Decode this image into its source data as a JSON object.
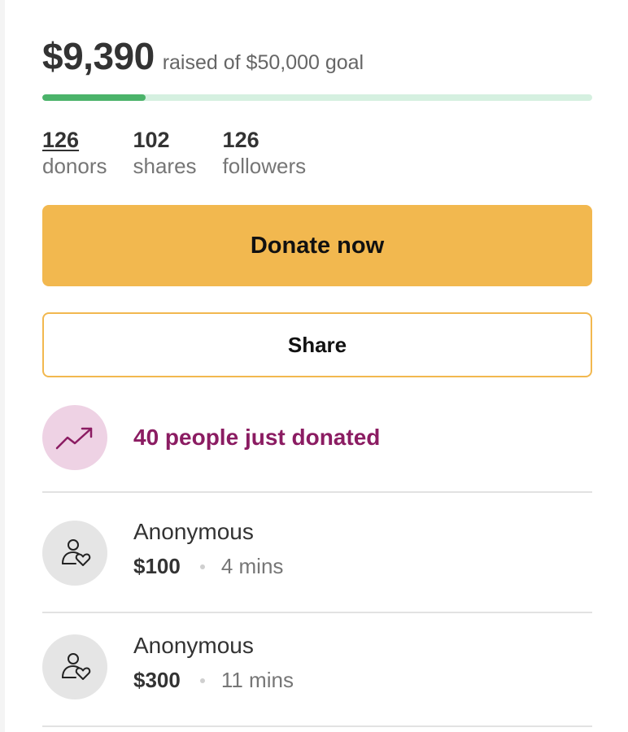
{
  "fundraiser": {
    "raised": "$9,390",
    "goal_text": "raised of $50,000 goal",
    "progress_fraction": 0.1878
  },
  "stats": [
    {
      "count": "126",
      "label": "donors"
    },
    {
      "count": "102",
      "label": "shares"
    },
    {
      "count": "126",
      "label": "followers"
    }
  ],
  "buttons": {
    "donate_label": "Donate now",
    "share_label": "Share"
  },
  "trending": {
    "icon": "trending-up-icon",
    "text": "40 people just donated"
  },
  "donations": [
    {
      "name": "Anonymous",
      "amount": "$100",
      "time": "4 mins",
      "icon": "donor-heart-icon"
    },
    {
      "name": "Anonymous",
      "amount": "$300",
      "time": "11 mins",
      "icon": "donor-heart-icon"
    }
  ],
  "colors": {
    "donate_button": "#f2b84f",
    "progress_fill": "#4bb36a",
    "progress_track": "#d5f0e0",
    "trending_text": "#8b1c62",
    "trending_bg": "#eed2e4"
  }
}
